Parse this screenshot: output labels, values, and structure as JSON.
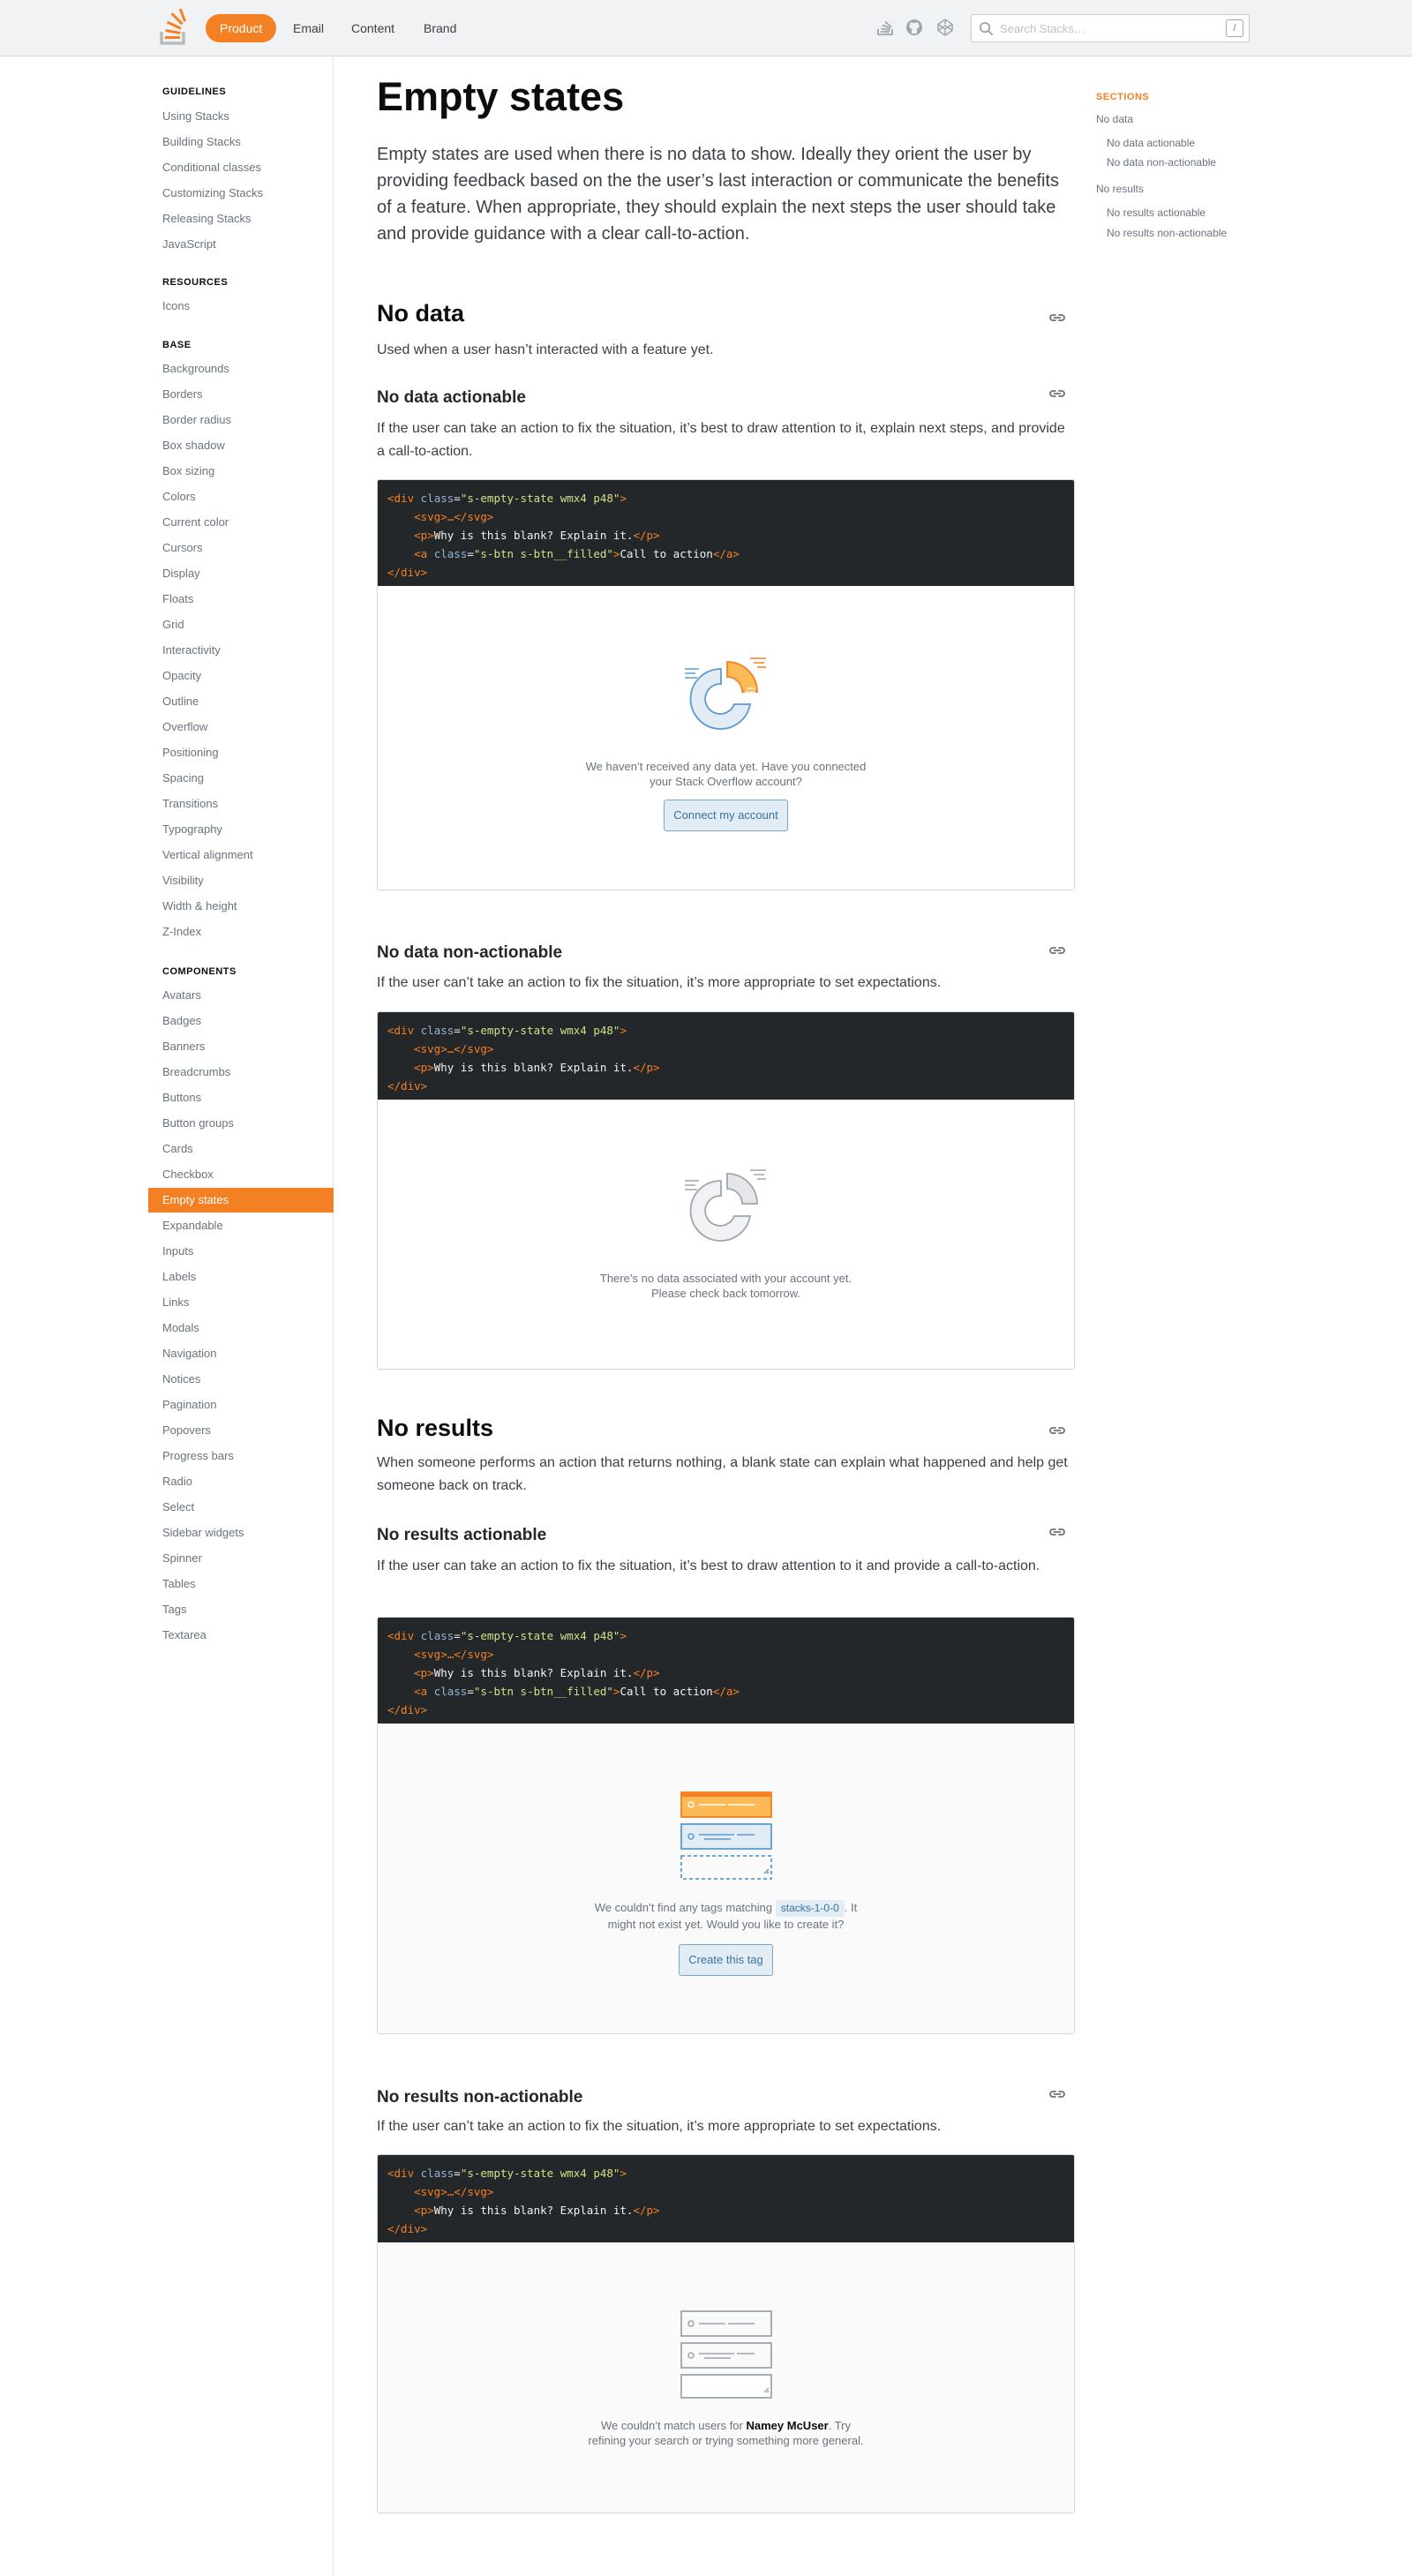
{
  "header": {
    "tabs": [
      {
        "label": "Product"
      },
      {
        "label": "Email"
      },
      {
        "label": "Content"
      },
      {
        "label": "Brand"
      }
    ],
    "search_placeholder": "Search Stacks…",
    "search_shortcut": "/",
    "icons": [
      "stack-icon",
      "github-icon",
      "codepen-icon"
    ]
  },
  "sidebar": {
    "sections": [
      {
        "title": "GUIDELINES",
        "items": [
          "Using Stacks",
          "Building Stacks",
          "Conditional classes",
          "Customizing Stacks",
          "Releasing Stacks",
          "JavaScript"
        ]
      },
      {
        "title": "RESOURCES",
        "items": [
          "Icons"
        ]
      },
      {
        "title": "BASE",
        "items": [
          "Backgrounds",
          "Borders",
          "Border radius",
          "Box shadow",
          "Box sizing",
          "Colors",
          "Current color",
          "Cursors",
          "Display",
          "Floats",
          "Grid",
          "Interactivity",
          "Opacity",
          "Outline",
          "Overflow",
          "Positioning",
          "Spacing",
          "Transitions",
          "Typography",
          "Vertical alignment",
          "Visibility",
          "Width & height",
          "Z-Index"
        ]
      },
      {
        "title": "COMPONENTS",
        "items": [
          "Avatars",
          "Badges",
          "Banners",
          "Breadcrumbs",
          "Buttons",
          "Button groups",
          "Cards",
          "Checkbox",
          "Empty states",
          "Expandable",
          "Inputs",
          "Labels",
          "Links",
          "Modals",
          "Navigation",
          "Notices",
          "Pagination",
          "Popovers",
          "Progress bars",
          "Radio",
          "Select",
          "Sidebar widgets",
          "Spinner",
          "Tables",
          "Tags",
          "Textarea"
        ]
      }
    ],
    "active_item": "Empty states"
  },
  "main": {
    "title": "Empty states",
    "lead": "Empty states are used when there is no data to show. Ideally they orient the user by providing feedback based on the the user’s last interaction or communicate the benefits of a feature. When appropriate, they should explain the next steps the user should take and provide guidance with a clear call-to-action.",
    "no_data": {
      "title": "No data",
      "desc": "Used when a user hasn’t interacted with a feature yet.",
      "actionable": {
        "title": "No data actionable",
        "desc": "If the user can take an action to fix the situation, it’s best to draw attention to it, explain next steps, and provide a call-to-action.",
        "demo_text_1": "We haven’t received any data yet. Have you connected",
        "demo_text_2": "your Stack Overflow account?",
        "button": "Connect my account"
      },
      "non_actionable": {
        "title": "No data non-actionable",
        "desc": "If the user can’t take an action to fix the situation, it’s more appropriate to set expectations.",
        "demo_text_1": "There’s no data associated with your account yet.",
        "demo_text_2": "Please check back tomorrow."
      }
    },
    "no_results": {
      "title": "No results",
      "desc": "When someone performs an action that returns nothing, a blank state can explain what happened and help get someone back on track.",
      "actionable": {
        "title": "No results actionable",
        "desc": "If the user can take an action to fix the situation, it’s best to draw attention to it and provide a call-to-action.",
        "demo_text_1a": "We couldn’t find any tags matching",
        "demo_tag": "stacks-1-0-0",
        "demo_text_1b": ". It",
        "demo_text_2": "might not exist yet. Would you like to create it?",
        "button": "Create this tag"
      },
      "non_actionable": {
        "title": "No results non-actionable",
        "desc": "If the user can’t take an action to fix the situation, it’s more appropriate to set expectations.",
        "demo_text_1a": "We couldn’t match users for",
        "demo_name": "Namey McUser",
        "demo_text_1b": ". Try",
        "demo_text_2": "refining your search or trying something more general."
      }
    },
    "code": {
      "div_open": "div",
      "class_attr": "class",
      "class_val": "\"s-empty-state wmx4 p48\"",
      "svg": "<svg>…</svg>",
      "p_text": "Why is this blank? Explain it.",
      "a_class_val": "\"s-btn s-btn__filled\"",
      "a_text": "Call to action"
    }
  },
  "rail": {
    "title": "SECTIONS",
    "items": [
      "No data",
      "No data actionable",
      "No data non-actionable",
      "No results",
      "No results actionable",
      "No results non-actionable"
    ]
  },
  "colors": {
    "accent": "#f48024",
    "code_bg": "#242729",
    "link_blue": "#39739d"
  }
}
